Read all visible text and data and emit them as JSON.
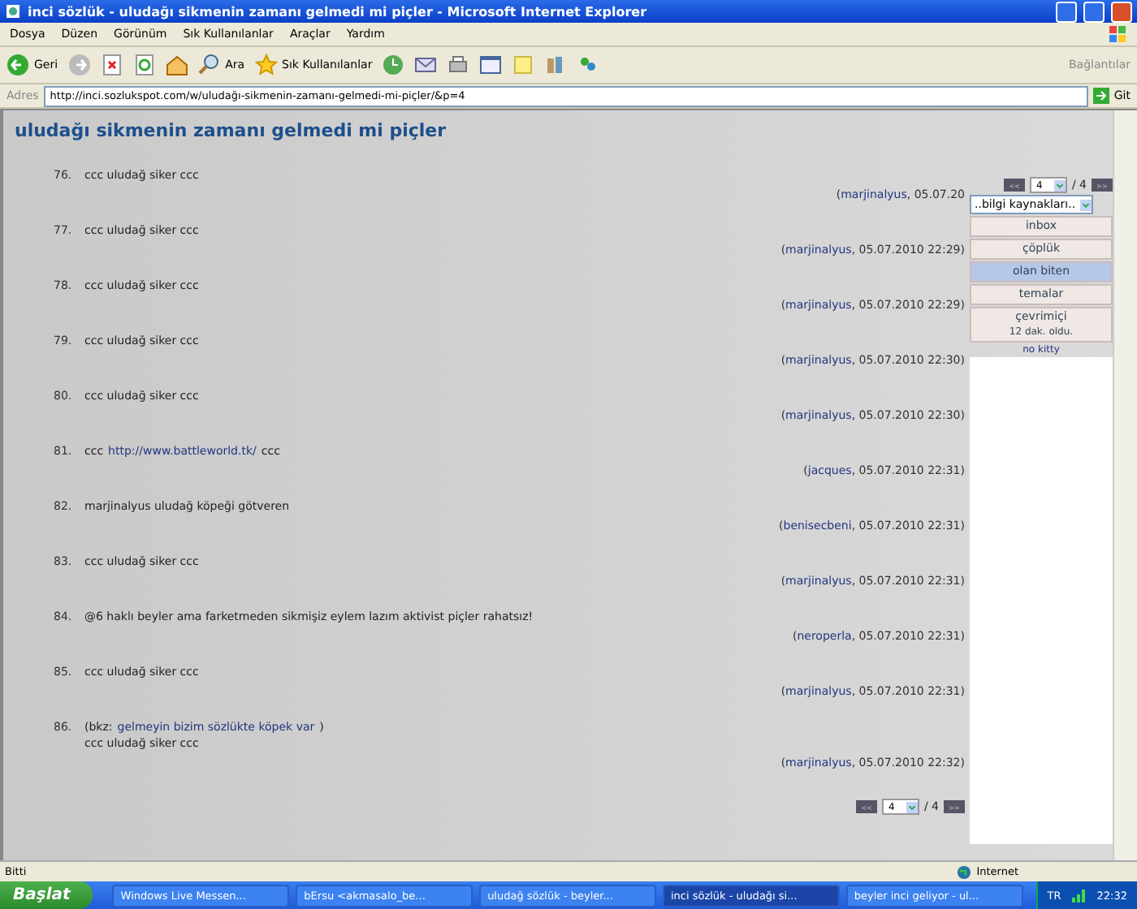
{
  "window": {
    "title": "inci sözlük - uludağı sikmenin zamanı gelmedi mi piçler - Microsoft Internet Explorer"
  },
  "menu": [
    "Dosya",
    "Düzen",
    "Görünüm",
    "Sık Kullanılanlar",
    "Araçlar",
    "Yardım"
  ],
  "toolbar": {
    "back": "Geri",
    "search": "Ara",
    "favorites": "Sık Kullanılanlar",
    "links": "Bağlantılar"
  },
  "address": {
    "label": "Adres",
    "url": "http://inci.sozlukspot.com/w/uludağı-sikmenin-zamanı-gelmedi-mi-piçler/&p=4",
    "go": "Git"
  },
  "page": {
    "heading": "uludağı sikmenin zamanı gelmedi mi piçler",
    "entries": [
      {
        "number": "76.",
        "lines": [
          [
            {
              "kind": "text",
              "text": "ccc uludağ siker ccc"
            }
          ]
        ],
        "byline": {
          "open": "(",
          "author": "marjinalyus",
          "rest": ", 05.07.20"
        }
      },
      {
        "number": "77.",
        "lines": [
          [
            {
              "kind": "text",
              "text": "ccc uludağ siker ccc"
            }
          ]
        ],
        "byline": {
          "open": "(",
          "author": "marjinalyus",
          "rest": ", 05.07.2010 22:29)"
        }
      },
      {
        "number": "78.",
        "lines": [
          [
            {
              "kind": "text",
              "text": "ccc uludağ siker ccc"
            }
          ]
        ],
        "byline": {
          "open": "(",
          "author": "marjinalyus",
          "rest": ", 05.07.2010 22:29)"
        }
      },
      {
        "number": "79.",
        "lines": [
          [
            {
              "kind": "text",
              "text": "ccc uludağ siker ccc"
            }
          ]
        ],
        "byline": {
          "open": "(",
          "author": "marjinalyus",
          "rest": ", 05.07.2010 22:30)"
        }
      },
      {
        "number": "80.",
        "lines": [
          [
            {
              "kind": "text",
              "text": "ccc uludağ siker ccc"
            }
          ]
        ],
        "byline": {
          "open": "(",
          "author": "marjinalyus",
          "rest": ", 05.07.2010 22:30)"
        }
      },
      {
        "number": "81.",
        "lines": [
          [
            {
              "kind": "text",
              "text": "ccc"
            },
            {
              "kind": "link",
              "text": "http://www.battleworld.tk/"
            },
            {
              "kind": "text",
              "text": "ccc"
            }
          ]
        ],
        "byline": {
          "open": "(",
          "author": "jacques",
          "rest": ", 05.07.2010 22:31)"
        }
      },
      {
        "number": "82.",
        "lines": [
          [
            {
              "kind": "text",
              "text": "marjinalyus uludağ köpeği götveren"
            }
          ]
        ],
        "byline": {
          "open": "(",
          "author": "benisecbeni",
          "rest": ", 05.07.2010 22:31)"
        }
      },
      {
        "number": "83.",
        "lines": [
          [
            {
              "kind": "text",
              "text": "ccc uludağ siker ccc"
            }
          ]
        ],
        "byline": {
          "open": "(",
          "author": "marjinalyus",
          "rest": ", 05.07.2010 22:31)"
        }
      },
      {
        "number": "84.",
        "lines": [
          [
            {
              "kind": "text",
              "text": "@6 haklı beyler ama farketmeden sikmişiz eylem lazım aktivist piçler rahatsız!"
            }
          ]
        ],
        "byline": {
          "open": "(",
          "author": "neroperla",
          "rest": ", 05.07.2010 22:31)"
        }
      },
      {
        "number": "85.",
        "lines": [
          [
            {
              "kind": "text",
              "text": "ccc uludağ siker ccc"
            }
          ]
        ],
        "byline": {
          "open": "(",
          "author": "marjinalyus",
          "rest": ", 05.07.2010 22:31)"
        }
      },
      {
        "number": "86.",
        "lines": [
          [
            {
              "kind": "text",
              "text": "(bkz:"
            },
            {
              "kind": "link",
              "text": "gelmeyin bizim sözlükte köpek var"
            },
            {
              "kind": "text",
              "text": ")"
            }
          ],
          [
            {
              "kind": "text",
              "text": "ccc uludağ siker ccc"
            }
          ]
        ],
        "byline": {
          "open": "(",
          "author": "marjinalyus",
          "rest": ", 05.07.2010 22:32)"
        }
      }
    ],
    "pager": {
      "page": "4",
      "total": "/ 4",
      "prev": "<<",
      "next": ">>"
    }
  },
  "panel": {
    "pager": {
      "page": "4",
      "total": "/ 4",
      "prev": "<<",
      "next": ">>"
    },
    "dropdown": "..bilgi kaynakları..",
    "items": [
      {
        "label": "inbox",
        "selected": false
      },
      {
        "label": "çöplük",
        "selected": false
      },
      {
        "label": "olan biten",
        "selected": true
      },
      {
        "label": "temalar",
        "selected": false
      },
      {
        "label": "çevrimiçi",
        "sub": "12 dak. oldu.",
        "selected": false
      }
    ],
    "user": "no kitty"
  },
  "status": {
    "text": "Bitti",
    "zone": "Internet"
  },
  "taskbar": {
    "start": "Başlat",
    "items": [
      {
        "label": "Windows Live Messen...",
        "selected": false
      },
      {
        "label": "bErsu <akmasalo_be...",
        "selected": false
      },
      {
        "label": "uludağ sözlük - beyler...",
        "selected": false
      },
      {
        "label": "inci sözlük - uludağı si...",
        "selected": true
      },
      {
        "label": "beyler inci geliyor - ul...",
        "selected": false
      }
    ],
    "lang": "TR",
    "clock": "22:32"
  }
}
